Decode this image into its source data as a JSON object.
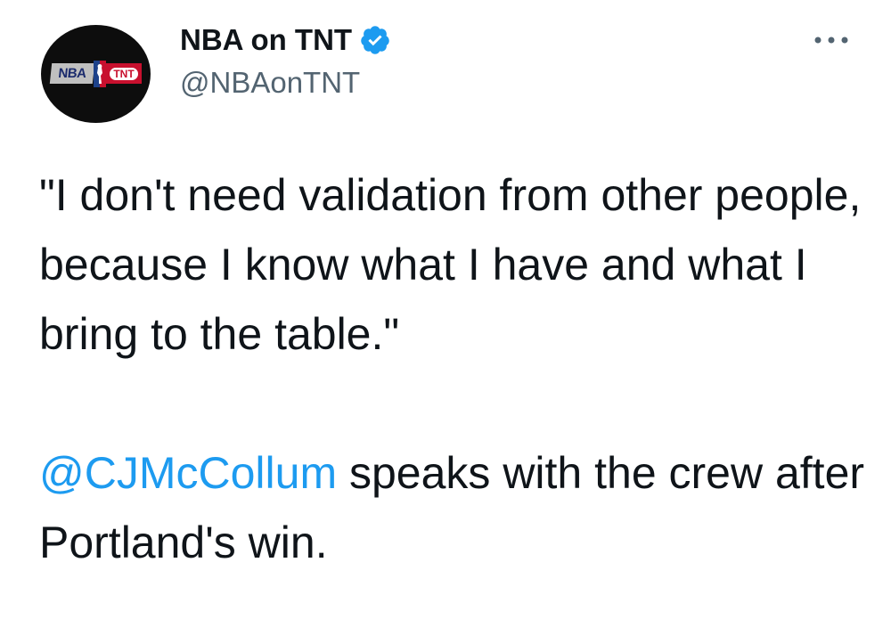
{
  "tweet": {
    "author": {
      "display_name": "NBA on TNT",
      "handle": "@NBAonTNT",
      "verified": true,
      "avatar_icon": "nba-on-tnt-logo",
      "avatar_text": {
        "nba": "NBA",
        "tnt": "TNT"
      }
    },
    "more_icon": "more-options-icon",
    "quote": "\"I don't need validation from other people, because I know what I have and what I bring to the table.\"",
    "mention": "@CJMcCollum",
    "caption_rest": " speaks with the crew after Portland's win."
  },
  "colors": {
    "text": "#0f1419",
    "secondary": "#536471",
    "link": "#1d9bf0",
    "verified": "#1d9bf0"
  }
}
